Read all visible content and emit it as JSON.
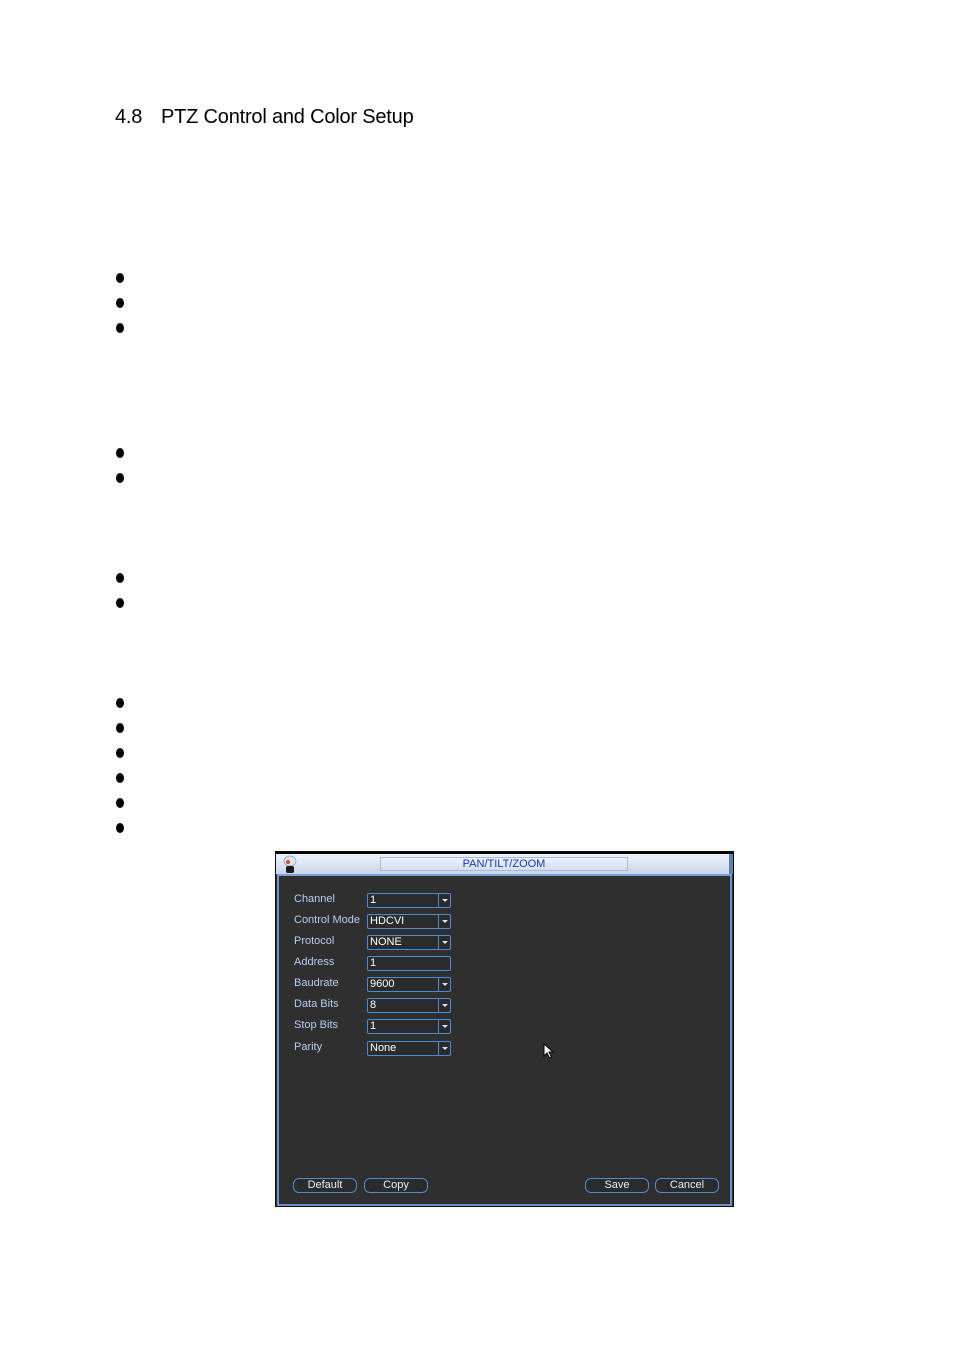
{
  "document": {
    "section_number": "4.8",
    "section_title": "PTZ Control and Color Setup",
    "bullet_groups": [
      {
        "count": 3
      },
      {
        "count": 2
      },
      {
        "count": 2
      },
      {
        "count": 6
      }
    ]
  },
  "dialog": {
    "title": "PAN/TILT/ZOOM",
    "logo_icon": "camera-logo-icon",
    "fields": [
      {
        "label": "Channel",
        "value": "1",
        "type": "dropdown"
      },
      {
        "label": "Control Mode",
        "value": "HDCVI",
        "type": "dropdown"
      },
      {
        "label": "Protocol",
        "value": "NONE",
        "type": "dropdown"
      },
      {
        "label": "Address",
        "value": "1",
        "type": "text"
      },
      {
        "label": "Baudrate",
        "value": "9600",
        "type": "dropdown"
      },
      {
        "label": "Data Bits",
        "value": "8",
        "type": "dropdown"
      },
      {
        "label": "Stop Bits",
        "value": "1",
        "type": "dropdown"
      },
      {
        "label": "Parity",
        "value": "None",
        "type": "dropdown"
      }
    ],
    "buttons": {
      "default": "Default",
      "copy": "Copy",
      "save": "Save",
      "cancel": "Cancel"
    },
    "colors": {
      "background": "#2f2f2f",
      "border_accent": "#4f8ad3",
      "label_text": "#b6cdf2",
      "title_text": "#1d35b8"
    }
  }
}
